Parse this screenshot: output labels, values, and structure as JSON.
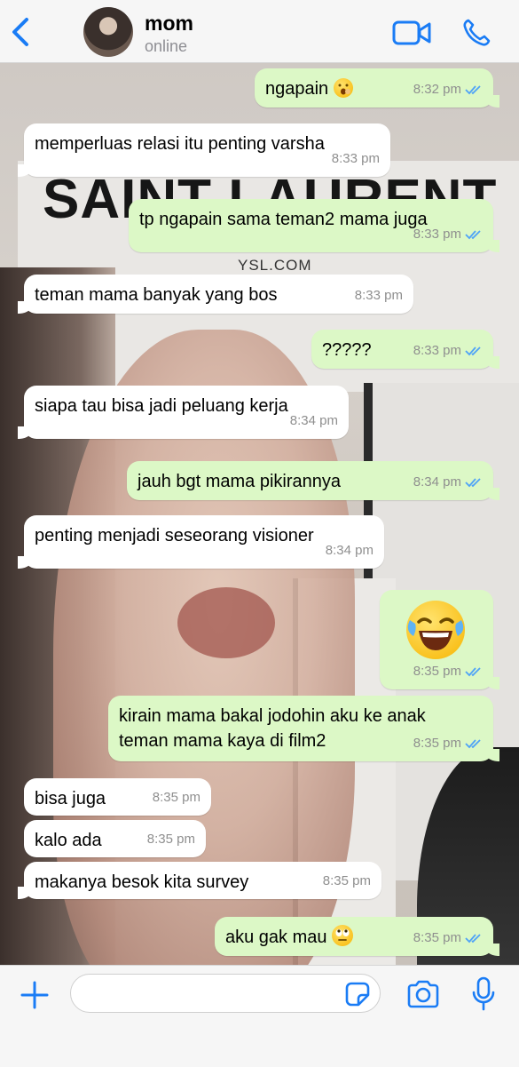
{
  "header": {
    "contact_name": "mom",
    "status": "online",
    "icons": [
      "chevron-left-icon",
      "video-camera-icon",
      "phone-icon"
    ]
  },
  "wallpaper": {
    "brand_text": "SAINT LAURENT",
    "url_text": "YSL.COM"
  },
  "messages": [
    {
      "side": "out",
      "text": "ngapain",
      "emoji": "yawning-face",
      "time": "8:32 pm",
      "read": true
    },
    {
      "side": "in",
      "text": "memperluas relasi itu penting varsha",
      "time": "8:33 pm"
    },
    {
      "side": "out",
      "text": "tp ngapain sama teman2 mama juga",
      "time": "8:33 pm",
      "read": true
    },
    {
      "side": "in",
      "text": "teman mama banyak yang bos",
      "time": "8:33 pm"
    },
    {
      "side": "out",
      "text": "?????",
      "time": "8:33 pm",
      "read": true
    },
    {
      "side": "in",
      "text": "siapa tau bisa jadi peluang kerja",
      "time": "8:34 pm"
    },
    {
      "side": "out",
      "text": "jauh bgt mama pikirannya",
      "time": "8:34 pm",
      "read": true
    },
    {
      "side": "in",
      "text": "penting menjadi seseorang visioner",
      "time": "8:34 pm"
    },
    {
      "side": "out",
      "text": "",
      "emoji": "face-with-tears-of-joy",
      "time": "8:35 pm",
      "read": true
    },
    {
      "side": "out",
      "text_line1": "kirain mama bakal jodohin aku ke anak",
      "text_line2": "teman mama kaya di film2",
      "time": "8:35 pm",
      "read": true
    },
    {
      "side": "in",
      "text": "bisa juga",
      "time": "8:35 pm"
    },
    {
      "side": "in",
      "text": "kalo ada",
      "time": "8:35 pm"
    },
    {
      "side": "in",
      "text": "makanya besok kita survey",
      "time": "8:35 pm"
    },
    {
      "side": "out",
      "text": "aku gak mau",
      "emoji": "face-with-rolling-eyes",
      "time": "8:35 pm",
      "read": true
    }
  ],
  "input_bar": {
    "placeholder": "",
    "icons": [
      "plus-icon",
      "sticker-icon",
      "camera-icon",
      "microphone-icon"
    ]
  },
  "colors": {
    "accent": "#1a7cf5",
    "outgoing_bubble": "#dcf8c6",
    "incoming_bubble": "#ffffff",
    "read_ticks": "#4fa3f7",
    "timestamp": "#8f8f8f"
  }
}
